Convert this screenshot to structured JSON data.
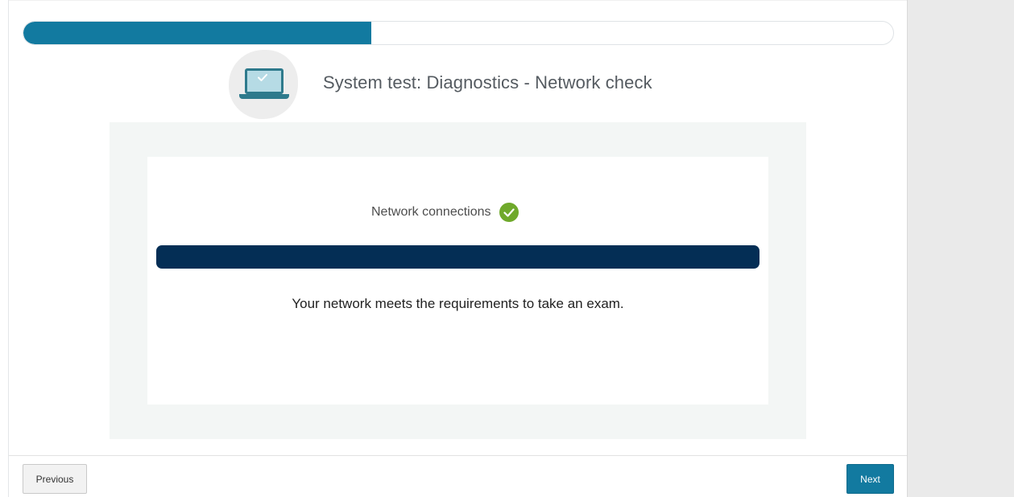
{
  "header": {
    "progress_fraction": 0.4,
    "title": "System test: Diagnostics - Network check",
    "icon": "laptop-check-icon"
  },
  "check": {
    "label": "Network connections",
    "status": "passed",
    "status_icon": "green-check-icon",
    "message": "Your network meets the requirements to take an exam."
  },
  "footer": {
    "previous_label": "Previous",
    "next_label": "Next"
  },
  "colors": {
    "accent": "#127aa0",
    "result_bar": "#042e55",
    "success": "#6fa92b"
  }
}
